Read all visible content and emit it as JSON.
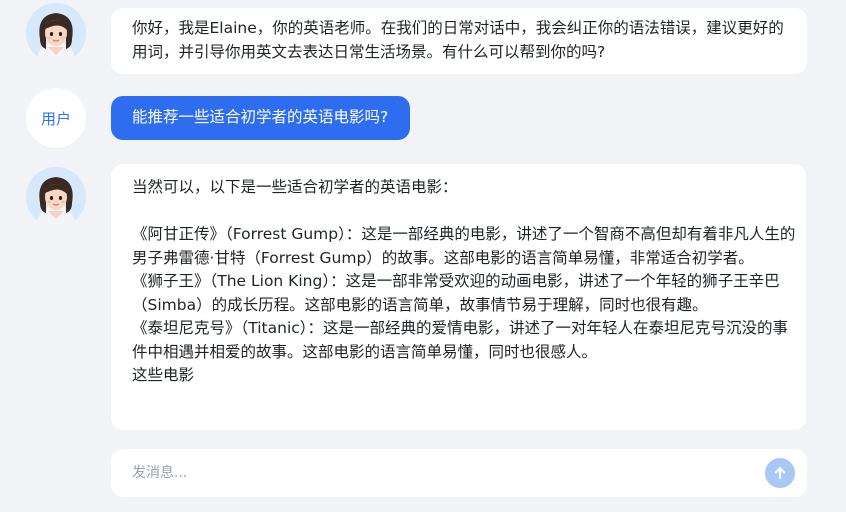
{
  "assistant": {
    "greeting": "你好，我是Elaine，你的英语老师。在我们的日常对话中，我会纠正你的语法错误，建议更好的用词，并引导你用英文去表达日常生活场景。有什么可以帮到你的吗?"
  },
  "user": {
    "avatar_label": "用户",
    "question": "能推荐一些适合初学者的英语电影吗?"
  },
  "reply": {
    "intro": "当然可以，以下是一些适合初学者的英语电影：",
    "movies": [
      "《阿甘正传》（Forrest Gump）：这是一部经典的电影，讲述了一个智商不高但却有着非凡人生的男子弗雷德·甘特（Forrest Gump）的故事。这部电影的语言简单易懂，非常适合初学者。",
      "《狮子王》（The Lion King）：这是一部非常受欢迎的动画电影，讲述了一个年轻的狮子王辛巴（Simba）的成长历程。这部电影的语言简单，故事情节易于理解，同时也很有趣。",
      "《泰坦尼克号》（Titanic）：这是一部经典的爱情电影，讲述了一对年轻人在泰坦尼克号沉没的事件中相遇并相爱的故事。这部电影的语言简单易懂，同时也很感人。"
    ],
    "trailing": "这些电影"
  },
  "composer": {
    "placeholder": "发消息..."
  },
  "icons": {
    "assistant_avatar": "woman-avatar-icon",
    "send": "arrow-up-icon"
  },
  "colors": {
    "accent": "#2f6df0",
    "send_disabled": "#a9c8f6",
    "background": "#f1f3f7"
  }
}
